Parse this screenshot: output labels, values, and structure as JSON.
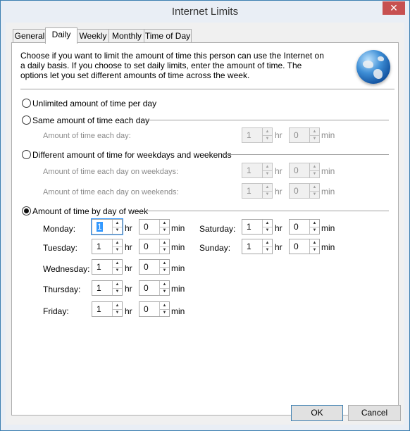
{
  "window": {
    "title": "Internet Limits",
    "close_glyph": "✕"
  },
  "tabs": [
    {
      "label": "General"
    },
    {
      "label": "Daily"
    },
    {
      "label": "Weekly"
    },
    {
      "label": "Monthly"
    },
    {
      "label": "Time of Day"
    }
  ],
  "active_tab": "Daily",
  "description": "Choose if you want to limit the amount of time this person can use the Internet on a daily basis. If you choose to set daily limits, enter the amount of time. The options let you set different amounts of time across the week.",
  "options": {
    "unlimited": {
      "label": "Unlimited amount of time per day",
      "selected": false
    },
    "same": {
      "label": "Same amount of time each day",
      "selected": false,
      "row": {
        "label": "Amount of time each day:",
        "hr": "1",
        "min": "0"
      }
    },
    "different": {
      "label": "Different amount of time for weekdays and weekends",
      "selected": false,
      "weekdays": {
        "label": "Amount of time each day on weekdays:",
        "hr": "1",
        "min": "0"
      },
      "weekends": {
        "label": "Amount of time each day on weekends:",
        "hr": "1",
        "min": "0"
      }
    },
    "by_day": {
      "label": "Amount of time by day of week",
      "selected": true
    }
  },
  "units": {
    "hr": "hr",
    "min": "min"
  },
  "spin_up": "▲",
  "spin_down": "▼",
  "days": {
    "monday": {
      "label": "Monday:",
      "hr": "1",
      "min": "0"
    },
    "tuesday": {
      "label": "Tuesday:",
      "hr": "1",
      "min": "0"
    },
    "wednesday": {
      "label": "Wednesday:",
      "hr": "1",
      "min": "0"
    },
    "thursday": {
      "label": "Thursday:",
      "hr": "1",
      "min": "0"
    },
    "friday": {
      "label": "Friday:",
      "hr": "1",
      "min": "0"
    },
    "saturday": {
      "label": "Saturday:",
      "hr": "1",
      "min": "0"
    },
    "sunday": {
      "label": "Sunday:",
      "hr": "1",
      "min": "0"
    }
  },
  "buttons": {
    "ok": "OK",
    "cancel": "Cancel"
  }
}
